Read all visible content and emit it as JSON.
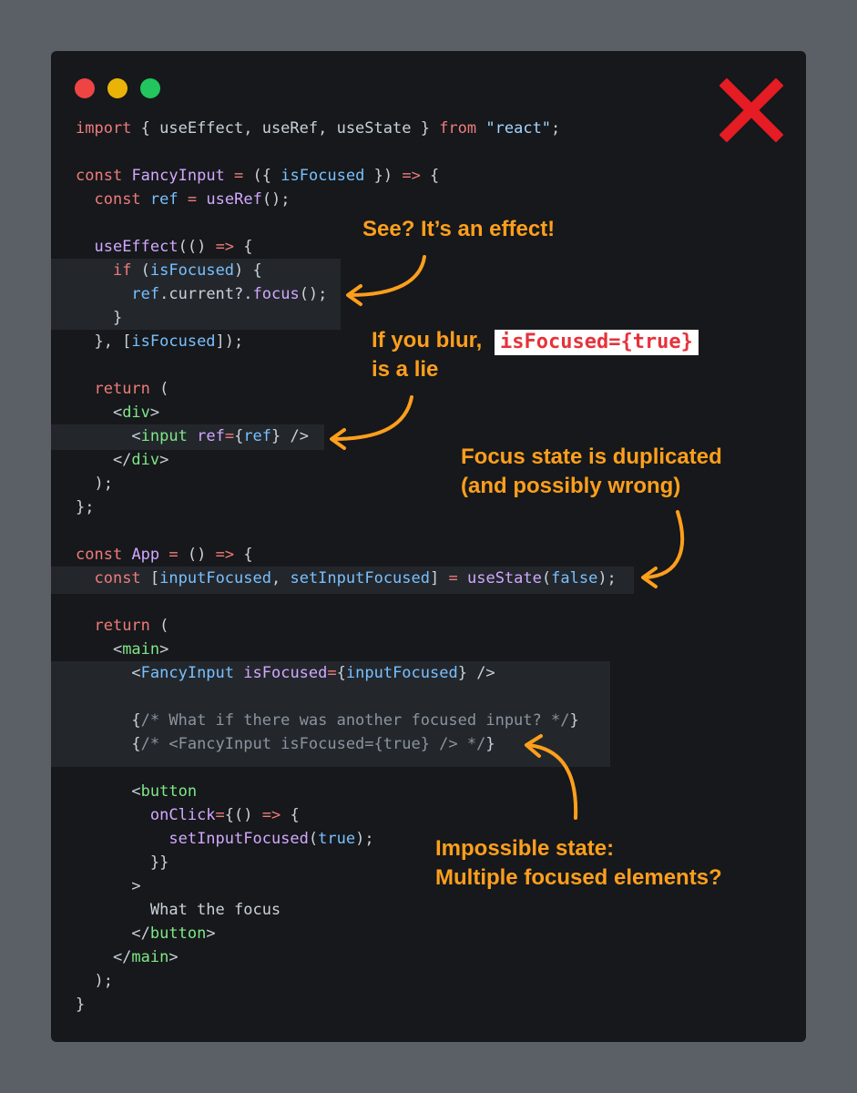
{
  "window": {
    "traffic_lights": [
      {
        "name": "close",
        "color": "#ef4444"
      },
      {
        "name": "minimize",
        "color": "#eab308"
      },
      {
        "name": "maximize",
        "color": "#22c55e"
      }
    ],
    "status_icon": "red-x-icon",
    "status_color": "#e51c23"
  },
  "colors": {
    "background": "#5b6066",
    "editor": "#16181b",
    "highlight": "#23272c",
    "annotation": "#ff9f1c",
    "badge_text": "#e5333b"
  },
  "code": {
    "lines": [
      [
        {
          "t": "kw",
          "v": "import"
        },
        {
          "t": "pl",
          "v": " { useEffect, useRef, useState } "
        },
        {
          "t": "kw",
          "v": "from"
        },
        {
          "t": "pl",
          "v": " "
        },
        {
          "t": "str",
          "v": "\"react\""
        },
        {
          "t": "pl",
          "v": ";"
        }
      ],
      [],
      [
        {
          "t": "kw",
          "v": "const"
        },
        {
          "t": "pl",
          "v": " "
        },
        {
          "t": "fn",
          "v": "FancyInput"
        },
        {
          "t": "pl",
          "v": " "
        },
        {
          "t": "op",
          "v": "="
        },
        {
          "t": "pl",
          "v": " ({ "
        },
        {
          "t": "var",
          "v": "isFocused"
        },
        {
          "t": "pl",
          "v": " }) "
        },
        {
          "t": "op",
          "v": "=>"
        },
        {
          "t": "pl",
          "v": " {"
        }
      ],
      [
        {
          "t": "pl",
          "v": "  "
        },
        {
          "t": "kw",
          "v": "const"
        },
        {
          "t": "pl",
          "v": " "
        },
        {
          "t": "var",
          "v": "ref"
        },
        {
          "t": "pl",
          "v": " "
        },
        {
          "t": "op",
          "v": "="
        },
        {
          "t": "pl",
          "v": " "
        },
        {
          "t": "fn",
          "v": "useRef"
        },
        {
          "t": "pl",
          "v": "();"
        }
      ],
      [],
      [
        {
          "t": "pl",
          "v": "  "
        },
        {
          "t": "fn",
          "v": "useEffect"
        },
        {
          "t": "pl",
          "v": "(() "
        },
        {
          "t": "op",
          "v": "=>"
        },
        {
          "t": "pl",
          "v": " {"
        }
      ],
      [
        {
          "t": "pl",
          "v": "    "
        },
        {
          "t": "kw",
          "v": "if"
        },
        {
          "t": "pl",
          "v": " ("
        },
        {
          "t": "var",
          "v": "isFocused"
        },
        {
          "t": "pl",
          "v": ") {"
        }
      ],
      [
        {
          "t": "pl",
          "v": "      "
        },
        {
          "t": "var",
          "v": "ref"
        },
        {
          "t": "pl",
          "v": ".current?."
        },
        {
          "t": "fn",
          "v": "focus"
        },
        {
          "t": "pl",
          "v": "();"
        }
      ],
      [
        {
          "t": "pl",
          "v": "    }"
        }
      ],
      [
        {
          "t": "pl",
          "v": "  }, ["
        },
        {
          "t": "var",
          "v": "isFocused"
        },
        {
          "t": "pl",
          "v": "]);"
        }
      ],
      [],
      [
        {
          "t": "pl",
          "v": "  "
        },
        {
          "t": "kw",
          "v": "return"
        },
        {
          "t": "pl",
          "v": " ("
        }
      ],
      [
        {
          "t": "pl",
          "v": "    <"
        },
        {
          "t": "tag",
          "v": "div"
        },
        {
          "t": "pl",
          "v": ">"
        }
      ],
      [
        {
          "t": "pl",
          "v": "      <"
        },
        {
          "t": "tag",
          "v": "input"
        },
        {
          "t": "pl",
          "v": " "
        },
        {
          "t": "fn",
          "v": "ref"
        },
        {
          "t": "op",
          "v": "="
        },
        {
          "t": "pl",
          "v": "{"
        },
        {
          "t": "var",
          "v": "ref"
        },
        {
          "t": "pl",
          "v": "} />"
        }
      ],
      [
        {
          "t": "pl",
          "v": "    </"
        },
        {
          "t": "tag",
          "v": "div"
        },
        {
          "t": "pl",
          "v": ">"
        }
      ],
      [
        {
          "t": "pl",
          "v": "  );"
        }
      ],
      [
        {
          "t": "pl",
          "v": "};"
        }
      ],
      [],
      [
        {
          "t": "kw",
          "v": "const"
        },
        {
          "t": "pl",
          "v": " "
        },
        {
          "t": "fn",
          "v": "App"
        },
        {
          "t": "pl",
          "v": " "
        },
        {
          "t": "op",
          "v": "="
        },
        {
          "t": "pl",
          "v": " () "
        },
        {
          "t": "op",
          "v": "=>"
        },
        {
          "t": "pl",
          "v": " {"
        }
      ],
      [
        {
          "t": "pl",
          "v": "  "
        },
        {
          "t": "kw",
          "v": "const"
        },
        {
          "t": "pl",
          "v": " ["
        },
        {
          "t": "var",
          "v": "inputFocused"
        },
        {
          "t": "pl",
          "v": ", "
        },
        {
          "t": "var",
          "v": "setInputFocused"
        },
        {
          "t": "pl",
          "v": "] "
        },
        {
          "t": "op",
          "v": "="
        },
        {
          "t": "pl",
          "v": " "
        },
        {
          "t": "fn",
          "v": "useState"
        },
        {
          "t": "pl",
          "v": "("
        },
        {
          "t": "var",
          "v": "false"
        },
        {
          "t": "pl",
          "v": ");"
        }
      ],
      [],
      [
        {
          "t": "pl",
          "v": "  "
        },
        {
          "t": "kw",
          "v": "return"
        },
        {
          "t": "pl",
          "v": " ("
        }
      ],
      [
        {
          "t": "pl",
          "v": "    <"
        },
        {
          "t": "tag",
          "v": "main"
        },
        {
          "t": "pl",
          "v": ">"
        }
      ],
      [
        {
          "t": "pl",
          "v": "      <"
        },
        {
          "t": "var",
          "v": "FancyInput"
        },
        {
          "t": "pl",
          "v": " "
        },
        {
          "t": "fn",
          "v": "isFocused"
        },
        {
          "t": "op",
          "v": "="
        },
        {
          "t": "pl",
          "v": "{"
        },
        {
          "t": "var",
          "v": "inputFocused"
        },
        {
          "t": "pl",
          "v": "} />"
        }
      ],
      [],
      [
        {
          "t": "pl",
          "v": "      {"
        },
        {
          "t": "cm",
          "v": "/* What if there was another focused input? */"
        },
        {
          "t": "pl",
          "v": "}"
        }
      ],
      [
        {
          "t": "pl",
          "v": "      {"
        },
        {
          "t": "cm",
          "v": "/* <FancyInput isFocused={true} /> */"
        },
        {
          "t": "pl",
          "v": "}"
        }
      ],
      [],
      [
        {
          "t": "pl",
          "v": "      <"
        },
        {
          "t": "tag",
          "v": "button"
        }
      ],
      [
        {
          "t": "pl",
          "v": "        "
        },
        {
          "t": "fn",
          "v": "onClick"
        },
        {
          "t": "op",
          "v": "="
        },
        {
          "t": "pl",
          "v": "{() "
        },
        {
          "t": "op",
          "v": "=>"
        },
        {
          "t": "pl",
          "v": " {"
        }
      ],
      [
        {
          "t": "pl",
          "v": "          "
        },
        {
          "t": "fn",
          "v": "setInputFocused"
        },
        {
          "t": "pl",
          "v": "("
        },
        {
          "t": "var",
          "v": "true"
        },
        {
          "t": "pl",
          "v": ");"
        }
      ],
      [
        {
          "t": "pl",
          "v": "        }}"
        }
      ],
      [
        {
          "t": "pl",
          "v": "      >"
        }
      ],
      [
        {
          "t": "pl",
          "v": "        What the focus"
        }
      ],
      [
        {
          "t": "pl",
          "v": "      </"
        },
        {
          "t": "tag",
          "v": "button"
        },
        {
          "t": "pl",
          "v": ">"
        }
      ],
      [
        {
          "t": "pl",
          "v": "    </"
        },
        {
          "t": "tag",
          "v": "main"
        },
        {
          "t": "pl",
          "v": ">"
        }
      ],
      [
        {
          "t": "pl",
          "v": "  );"
        }
      ],
      [
        {
          "t": "pl",
          "v": "}"
        }
      ]
    ]
  },
  "annotations": {
    "effect_note": "See? It’s an effect!",
    "blur_note_line1": "If you blur,",
    "blur_note_badge": "isFocused={true}",
    "blur_note_line2": "is a lie",
    "duplicate_note_line1": "Focus state is duplicated",
    "duplicate_note_line2": "(and possibly wrong)",
    "impossible_note_line1": "Impossible state:",
    "impossible_note_line2": "Multiple focused elements?"
  }
}
